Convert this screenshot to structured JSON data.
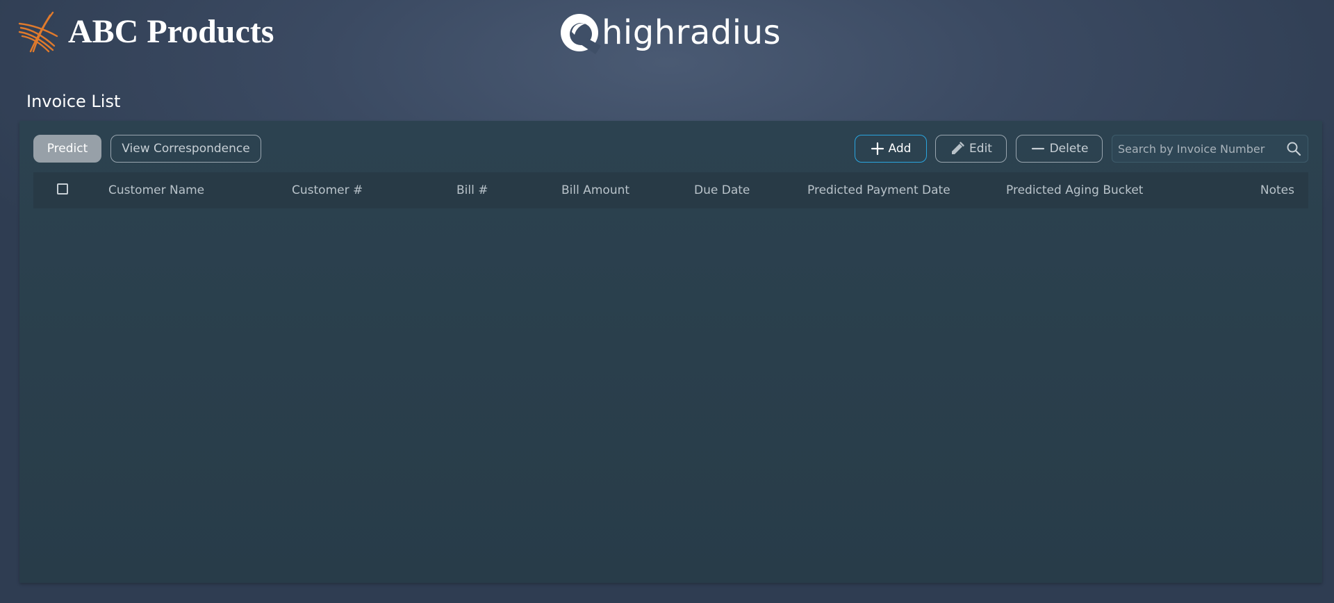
{
  "header": {
    "brand_name": "ABC Products",
    "partner_logo_text": "highradius"
  },
  "page": {
    "title": "Invoice List"
  },
  "toolbar": {
    "predict_label": "Predict",
    "view_correspondence_label": "View Correspondence",
    "add_label": "Add",
    "edit_label": "Edit",
    "delete_label": "Delete",
    "search_placeholder": "Search by Invoice Number",
    "search_value": ""
  },
  "table": {
    "columns": [
      "Customer Name",
      "Customer #",
      "Bill #",
      "Bill Amount",
      "Due Date",
      "Predicted Payment Date",
      "Predicted Aging Bucket",
      "Notes"
    ],
    "rows": []
  },
  "icons": {
    "brand": "abc-crossed-lines-icon",
    "partner": "highradius-swirl-icon",
    "add": "plus-icon",
    "edit": "pencil-icon",
    "delete": "minus-icon",
    "search": "search-icon",
    "select_all": "checkbox-icon"
  },
  "colors": {
    "brand_orange": "#e07a2c",
    "add_border": "#2aa6e0",
    "predict_bg": "#97a0a8",
    "panel_bg": "#2a3f4c"
  }
}
